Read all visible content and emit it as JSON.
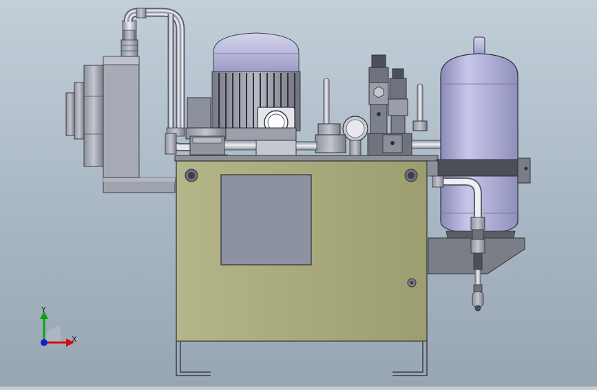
{
  "viewport": {
    "background_top": "#c2cfd9",
    "background_bottom": "#98a6b4",
    "model_description_visible": false
  },
  "colors": {
    "tank_body": "#a8aa7c",
    "accumulator": "#a7a7d2",
    "motor_head": "#b4b4d8",
    "steel": "#a9adb8",
    "dark_steel": "#5e626c",
    "window": "#8d92a3",
    "axis_x": "#d01010",
    "axis_y": "#10a010",
    "axis_z": "#1020d0"
  },
  "triad": {
    "x_label": "X",
    "y_label": "Y"
  }
}
